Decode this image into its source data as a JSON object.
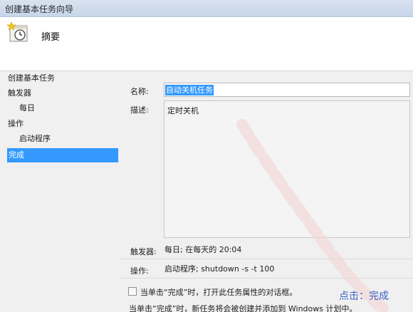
{
  "window": {
    "title": "创建基本任务向导"
  },
  "header": {
    "title": "摘要",
    "icon": "task-scheduler-clock-icon"
  },
  "nav": {
    "items": [
      {
        "label": "创建基本任务",
        "level": 0,
        "selected": false
      },
      {
        "label": "触发器",
        "level": 0,
        "selected": false
      },
      {
        "label": "每日",
        "level": 1,
        "selected": false
      },
      {
        "label": "操作",
        "level": 0,
        "selected": false
      },
      {
        "label": "启动程序",
        "level": 1,
        "selected": false
      },
      {
        "label": "完成",
        "level": 0,
        "selected": true
      }
    ]
  },
  "summary": {
    "name_label": "名称:",
    "name_value": "自动关机任务",
    "description_label": "描述:",
    "description_value": "定时关机",
    "trigger_label": "触发器:",
    "trigger_value": "每日; 在每天的 20:04",
    "action_label": "操作:",
    "action_value": "启动程序; shutdown -s -t 100",
    "open_properties_checkbox": {
      "label": "当单击“完成”时，打开此任务属性的对话框。",
      "checked": false
    },
    "footer_note": "当单击“完成”时，新任务将会被创建并添加到 Windows 计划中。"
  },
  "overlay": {
    "hint": "点击：完成"
  },
  "colors": {
    "selection": "#3399ff",
    "hint": "#3a62c4",
    "watermark": "#f3d6d6"
  }
}
